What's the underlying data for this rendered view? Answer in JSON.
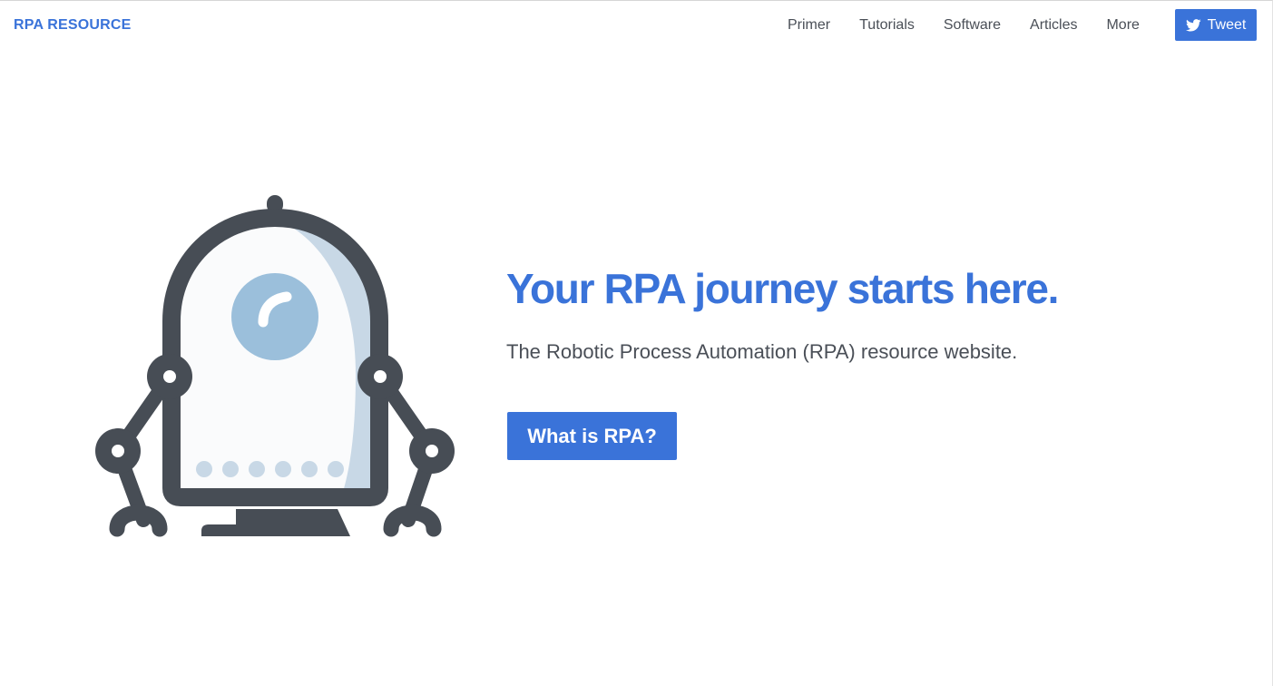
{
  "navbar": {
    "brand": "RPA RESOURCE",
    "links": [
      "Primer",
      "Tutorials",
      "Software",
      "Articles",
      "More"
    ],
    "tweet_label": "Tweet",
    "tweet_icon": "twitter-bird-icon"
  },
  "hero": {
    "illustration": "robot-icon",
    "title": "Your RPA journey starts here.",
    "subtitle": "The Robotic Process Automation (RPA) resource website.",
    "cta_label": "What is RPA?"
  },
  "colors": {
    "accent": "#3a73d9",
    "text": "#4a4f57",
    "robot_dark": "#474d55",
    "robot_light": "#9bbfdb",
    "robot_shade": "#c8d8e6"
  }
}
